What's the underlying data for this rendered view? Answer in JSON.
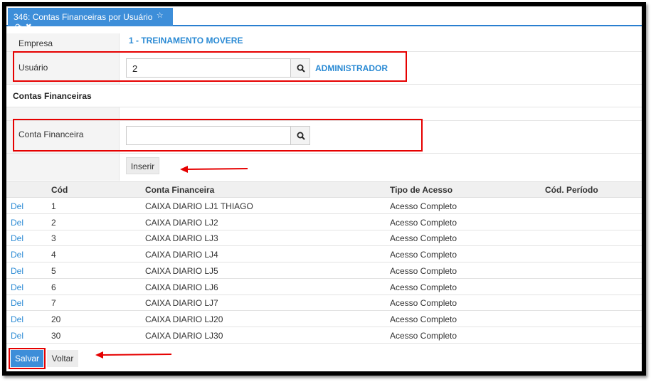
{
  "tab": {
    "title": "346: Contas Financeiras por Usuário",
    "icons": [
      "star-icon",
      "refresh-icon",
      "close-icon"
    ]
  },
  "form": {
    "empresa_label": "Empresa",
    "empresa_value": "1 - TREINAMENTO MOVERE",
    "usuario_label": "Usuário",
    "usuario_value": "2",
    "usuario_name": "ADMINISTRADOR",
    "section_title": "Contas Financeiras",
    "conta_label": "Conta Financeira",
    "conta_value": "",
    "inserir_label": "Inserir"
  },
  "table": {
    "headers": {
      "del": "",
      "cod": "Cód",
      "conta": "Conta Financeira",
      "tipo": "Tipo de Acesso",
      "periodo": "Cód. Período"
    },
    "rows": [
      {
        "del": "Del",
        "cod": "1",
        "conta": "CAIXA DIARIO LJ1 THIAGO",
        "tipo": "Acesso Completo",
        "periodo": ""
      },
      {
        "del": "Del",
        "cod": "2",
        "conta": "CAIXA DIARIO LJ2",
        "tipo": "Acesso Completo",
        "periodo": ""
      },
      {
        "del": "Del",
        "cod": "3",
        "conta": "CAIXA DIARIO LJ3",
        "tipo": "Acesso Completo",
        "periodo": ""
      },
      {
        "del": "Del",
        "cod": "4",
        "conta": "CAIXA DIARIO LJ4",
        "tipo": "Acesso Completo",
        "periodo": ""
      },
      {
        "del": "Del",
        "cod": "5",
        "conta": "CAIXA DIARIO LJ5",
        "tipo": "Acesso Completo",
        "periodo": ""
      },
      {
        "del": "Del",
        "cod": "6",
        "conta": "CAIXA DIARIO LJ6",
        "tipo": "Acesso Completo",
        "periodo": ""
      },
      {
        "del": "Del",
        "cod": "7",
        "conta": "CAIXA DIARIO LJ7",
        "tipo": "Acesso Completo",
        "periodo": ""
      },
      {
        "del": "Del",
        "cod": "20",
        "conta": "CAIXA DIARIO LJ20",
        "tipo": "Acesso Completo",
        "periodo": ""
      },
      {
        "del": "Del",
        "cod": "30",
        "conta": "CAIXA DIARIO LJ30",
        "tipo": "Acesso Completo",
        "periodo": ""
      }
    ]
  },
  "footer": {
    "salvar_label": "Salvar",
    "voltar_label": "Voltar"
  },
  "colors": {
    "accent": "#3d8ed9",
    "link": "#2a8ad4",
    "highlight": "#e60000"
  }
}
